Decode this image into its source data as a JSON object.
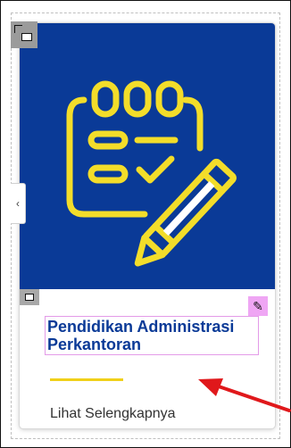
{
  "card": {
    "title": "Pendidikan Administrasi Perkantoran",
    "link_text": "Lihat Selengkapnya"
  },
  "colors": {
    "hero_bg": "#0a3a97",
    "icon_yellow": "#f3dd2a",
    "title_color": "#0a3a97",
    "divider": "#f0d01a",
    "edit_highlight": "#efa6f4",
    "annotation_arrow": "#e0181b"
  },
  "icons": {
    "hero": "clipboard-checklist-pencil-icon",
    "widget_handle": "widget-handle-icon",
    "edit": "pencil-edit-icon",
    "collapse": "chevron-left-icon"
  }
}
